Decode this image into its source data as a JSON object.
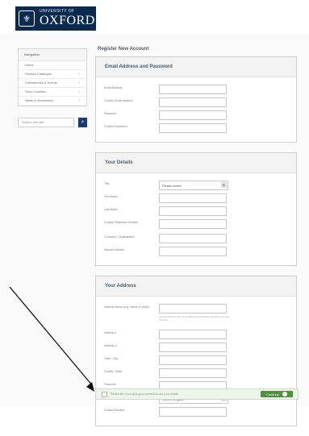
{
  "brand": {
    "top": "UNIVERSITY OF",
    "name": "OXFORD",
    "color": "#0b2a4f"
  },
  "nav": {
    "title": "Navigation",
    "items": [
      "Home",
      "Product Catalogue",
      "Conferences & Events",
      "Short Courses",
      "News & Information"
    ]
  },
  "search": {
    "placeholder": "Search this site"
  },
  "page": {
    "title": "Register New Account"
  },
  "sections": {
    "email": {
      "title": "Email Address and Password",
      "fields": [
        "Email Address",
        "Confirm Email Address",
        "Password",
        "Confirm Password"
      ]
    },
    "details": {
      "title": "Your Details",
      "title_label": "Title",
      "title_value": "Please select",
      "fields": [
        "First Name",
        "Last Name",
        "Contact Telephone Number",
        "Company / Organisation",
        "Student Number"
      ]
    },
    "address": {
      "title": "Your Address",
      "lookup_label": "Address Name (e.g. Name or Work)",
      "lookup_hint": "Use this field to name this address and choose one above to save the field.",
      "fields": [
        "Address 1",
        "Address 2",
        "Town / City",
        "County / State",
        "Postcode"
      ],
      "country_label": "Country",
      "country_value": "United Kingdom",
      "last_field": "Contact Number"
    }
  },
  "footer": {
    "consent": "Please tick if you give your consent to use your details",
    "continue_label": "Continue",
    "accent": "#4f8f3e"
  }
}
